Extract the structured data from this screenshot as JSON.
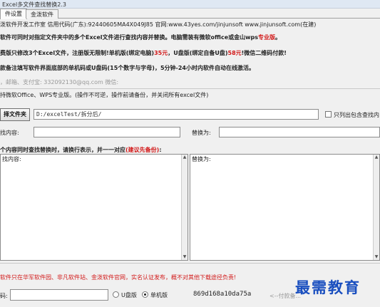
{
  "window": {
    "title": "Excel多文件查找替换2.3"
  },
  "tabs": [
    {
      "label": "件设置"
    },
    {
      "label": "金泼软件"
    }
  ],
  "info": {
    "line1_a": "泼软件开发工作室 信用代码(广东):92440605MA4X049J85 官网:www.43yes.com/jinjunsoft  www.jinjunsoft.com(在建)",
    "line2_a": "软件可同时对指定文件夹中的多个Excel文件进行查找内容并替换。电脑需装有微软office或金山wps",
    "line2_red": "专业版",
    "line2_b": "。",
    "line3_a": "费版只修改3个Excel文件，注册版无限制!单机版(绑定电脑)",
    "line3_red1": "35元",
    "line3_b": "，U盘版(绑定自备U盘)",
    "line3_red2": "58元",
    "line3_c": "!微信二维码付款!",
    "line4": "款备注填写软件界面底部的单机码或U盘码(15个数字与字母)，5分钟-24小时内软件自动在线激活。",
    "line5": "，邮箱、支付宝: 332092130@qq.com  微信:"
  },
  "options": {
    "compat_label": "持微软Office、WPS专业版。(操作不可逆，操作前请备份，并关闭所有excel文件)"
  },
  "folder": {
    "button_label": "择文件夹",
    "path_value": "D:/excelTest/拆分后/",
    "only_list_label": "只列出包含查找内"
  },
  "search": {
    "find_label": "找内容:",
    "find_value": "",
    "replace_label": "替换为:",
    "replace_value": ""
  },
  "multi": {
    "title_a": "个内容同时查找替换时，请换行表示，并一一对应",
    "title_red": "(建议先备份)",
    "title_b": ":",
    "find_caption": "找内容:",
    "replace_caption": "替换为:"
  },
  "notice": "软件只在华军软件园、非凡软件站、金泼软件官网，实名认证发布，概不对其他下载途径负责!",
  "bottom": {
    "code_label": "码:",
    "code_value": "",
    "usb_label": "U盘版",
    "single_label": "单机版",
    "machine_code": "869d168a10da75a",
    "pay_hint": "<--付款备...",
    "selected": "single"
  },
  "watermark": "最需教育",
  "colors": {
    "accent_red": "#d21a1a",
    "watermark_blue": "#1a4fbf"
  }
}
